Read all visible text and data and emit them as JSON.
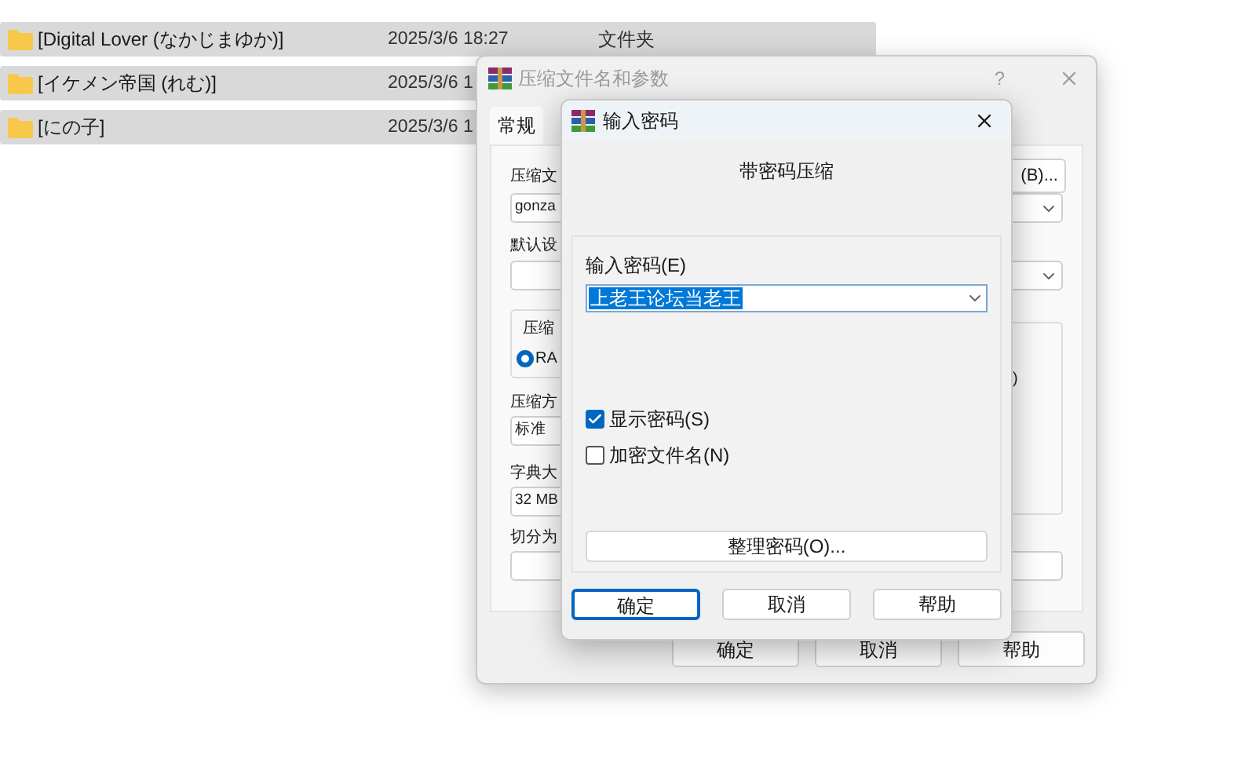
{
  "file_list": {
    "rows": [
      {
        "name": "[Digital Lover (なかじまゆか)]",
        "date": "2025/3/6 18:27",
        "type": "文件夹",
        "selected": true
      },
      {
        "name": "[イケメン帝国 (れむ)]",
        "date": "2025/3/6 1",
        "selected": true
      },
      {
        "name": "[にの子]",
        "date": "2025/3/6 1",
        "selected": true
      }
    ]
  },
  "archive_dialog": {
    "title": "压缩文件名和参数",
    "help_glyph": "?",
    "tabs": [
      {
        "label": "常规",
        "selected": true
      }
    ],
    "archive_name_label": "压缩文",
    "browse_button": "(B)...",
    "archive_name_value": "gonza",
    "profile_label": "默认设",
    "format_group_label": "压缩",
    "format_option": {
      "label": "RA",
      "selected": true
    },
    "options_group_text": ")",
    "method_label": "压缩方",
    "method_value": "标准",
    "dictionary_label": "字典大",
    "dictionary_value": "32 MB",
    "split_label": "切分为",
    "buttons": [
      "确定",
      "取消",
      "帮助"
    ]
  },
  "password_dialog": {
    "title": "输入密码",
    "heading": "带密码压缩",
    "password_label": "输入密码(E)",
    "password_value": "上老王论坛当老王",
    "options": [
      {
        "label": "显示密码(S)",
        "checked": true
      },
      {
        "label": "加密文件名(N)",
        "checked": false
      }
    ],
    "organize_button": "整理密码(O)...",
    "buttons": [
      {
        "label": "确定",
        "default": true
      },
      {
        "label": "取消",
        "default": false
      },
      {
        "label": "帮助",
        "default": false
      }
    ]
  }
}
